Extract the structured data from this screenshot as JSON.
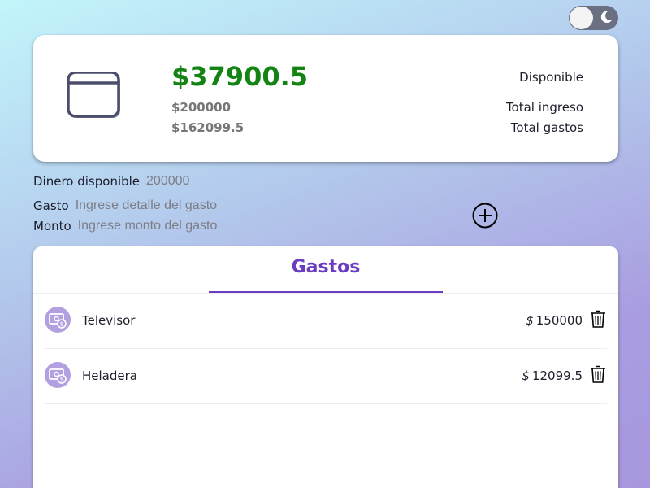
{
  "theme_toggle": {
    "icon": "moon-icon",
    "state": "light"
  },
  "summary": {
    "icon": "wallet-icon",
    "available_amount": "$37900.5",
    "income_amount": "$200000",
    "expenses_amount": "$162099.5",
    "available_label": "Disponible",
    "income_label": "Total ingreso",
    "expenses_label": "Total gastos",
    "available_color": "#138313"
  },
  "form": {
    "budget_label": "Dinero disponible",
    "budget_placeholder": "200000",
    "expense_label": "Gasto",
    "expense_placeholder": "Ingrese detalle del gasto",
    "amount_label": "Monto",
    "amount_placeholder": "Ingrese monto del gasto",
    "add_icon": "plus-circle-icon"
  },
  "expenses": {
    "title": "Gastos",
    "accent": "#6a3cc0",
    "currency": "$",
    "items": [
      {
        "name": "Televisor",
        "amount": "150000"
      },
      {
        "name": "Heladera",
        "amount": "12099.5"
      }
    ]
  }
}
